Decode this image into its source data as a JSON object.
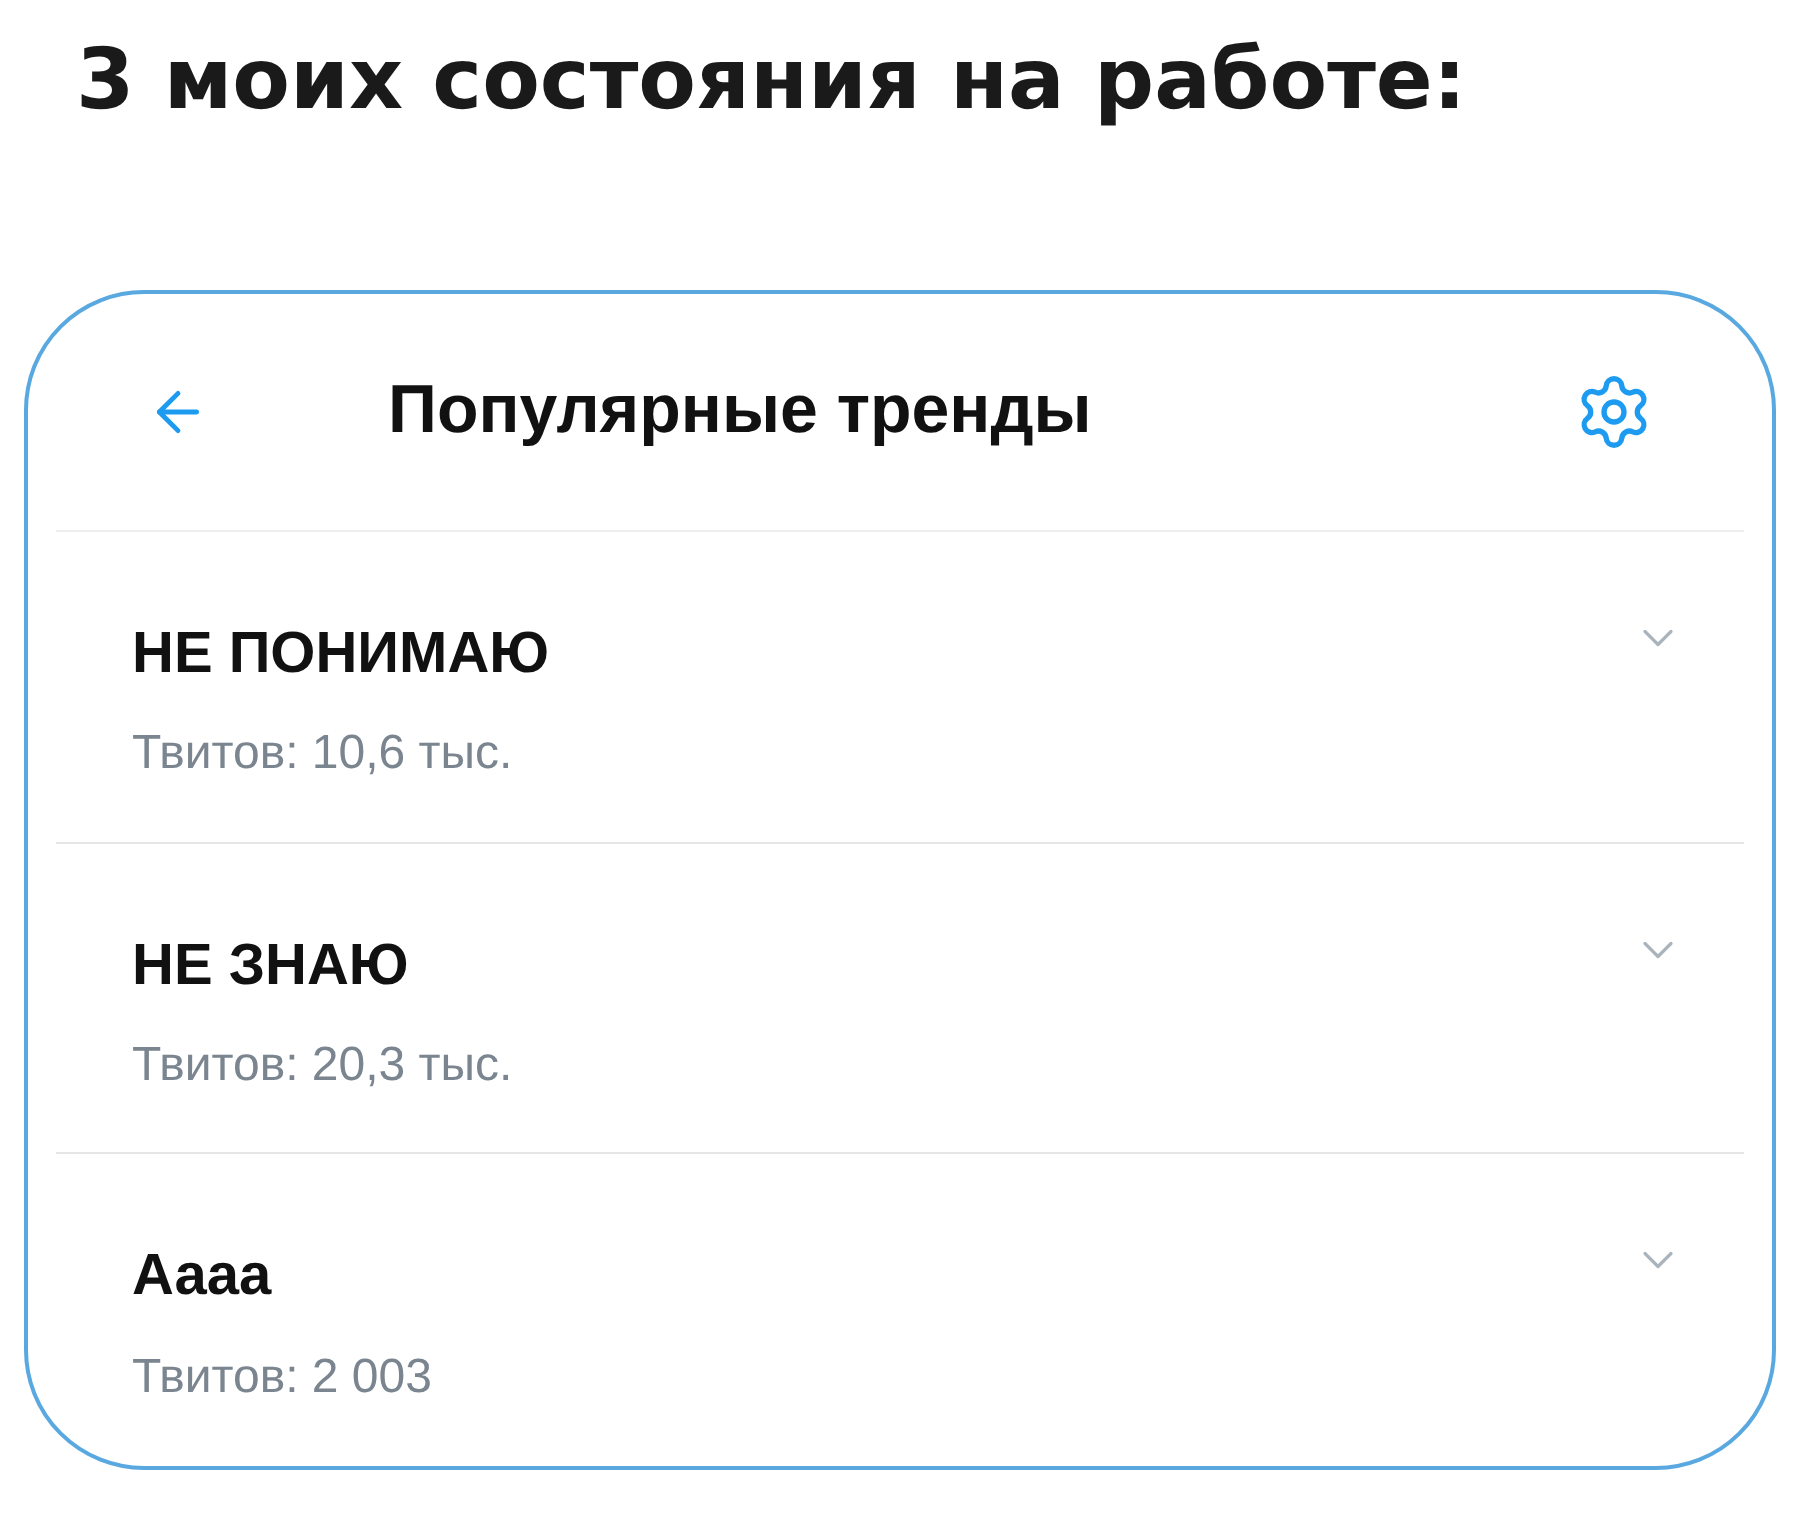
{
  "caption": "3 моих состояния на работе:",
  "header": {
    "title": "Популярные тренды"
  },
  "trends": [
    {
      "name": "НЕ ПОНИМАЮ",
      "count": "Твитов: 10,6 тыс."
    },
    {
      "name": "НЕ ЗНАЮ",
      "count": "Твитов: 20,3 тыс."
    },
    {
      "name": "Аааа",
      "count": "Твитов: 2 003"
    }
  ]
}
